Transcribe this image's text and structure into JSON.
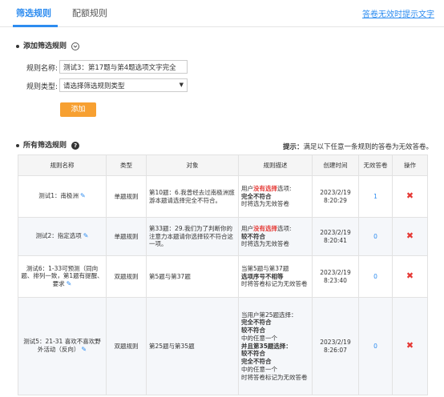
{
  "tabs": {
    "active": "筛选规则",
    "inactive": "配额规则"
  },
  "top_link": "答卷无效时提示文字",
  "add_section": {
    "title": "添加筛选规则",
    "name_label": "规则名称:",
    "name_value": "测试3：第17题与第4题选项文字完全",
    "type_label": "规则类型:",
    "type_value": "请选择筛选规则类型",
    "add_button": "添加"
  },
  "all_section": {
    "title": "所有筛选规则",
    "hint_bold": "提示：",
    "hint_text": "满足以下任意一条规则的答卷为无效答卷。"
  },
  "table": {
    "headers": [
      "规则名称",
      "类型",
      "对象",
      "规则描述",
      "创建时间",
      "无效答卷",
      "操作"
    ],
    "rows": [
      {
        "name": "测试1：南极洲",
        "type": "单题规则",
        "object": "第10题：6.我曾经去过南极洲旅游本题请选择完全不符合。",
        "desc1": "用户",
        "desc_red": "没有选择",
        "desc2": "选项:",
        "desc_bold": "完全不符合",
        "desc3": "时将选为无效答卷",
        "time": "2023/2/19 8:20:29",
        "count": "1"
      },
      {
        "name": "测试2：指定选项",
        "type": "单题规则",
        "object": "第33题：29.我们为了判断你的注意力本题请你选择较不符合这一项。",
        "desc1": "用户",
        "desc_red": "没有选择",
        "desc2": "选项:",
        "desc_bold": "较不符合",
        "desc3": "时将选为无效答卷",
        "time": "2023/2/19 8:20:41",
        "count": "0"
      },
      {
        "name": "测试6：1-33可预测（同向题、排列一致，第1题有提醒、要求",
        "type": "双题规则",
        "object": "第5题与第37题",
        "desc1": "当第5题与第37题",
        "desc_bold": "选项序号不相等",
        "desc3": "时将答卷标记为无效答卷",
        "time": "2023/2/19 8:23:40",
        "count": "0"
      },
      {
        "name": "测试5：21-31 喜欢不喜欢野外活动（反向）",
        "type": "双题规则",
        "object": "第25题与第35题",
        "desc_lines": [
          "当用户第25题选择：",
          "完全不符合",
          "较不符合",
          "中的任意一个",
          "并且第35题选择：",
          "较不符合",
          "完全不符合",
          "中的任意一个",
          "时将答卷标记为无效答卷"
        ],
        "time": "2023/2/19 8:26:07",
        "count": "0"
      }
    ]
  }
}
